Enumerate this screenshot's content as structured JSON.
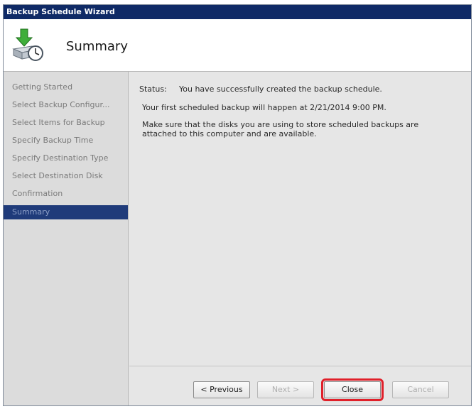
{
  "window": {
    "title": "Backup Schedule Wizard"
  },
  "header": {
    "title": "Summary"
  },
  "nav": {
    "items": [
      {
        "label": "Getting Started"
      },
      {
        "label": "Select Backup Configur..."
      },
      {
        "label": "Select Items for Backup"
      },
      {
        "label": "Specify Backup Time"
      },
      {
        "label": "Specify Destination Type"
      },
      {
        "label": "Select Destination Disk"
      },
      {
        "label": "Confirmation"
      },
      {
        "label": "Summary"
      }
    ],
    "selected_index": 7
  },
  "content": {
    "status_label": "Status:",
    "status_text": "You have successfully created the backup schedule.",
    "first_backup": "Your first scheduled backup will happen at 2/21/2014 9:00 PM.",
    "note": "Make sure that the disks you are using to store scheduled backups are attached to this computer and are available."
  },
  "buttons": {
    "previous": "< Previous",
    "next": "Next >",
    "close": "Close",
    "cancel": "Cancel"
  },
  "colors": {
    "titlebar": "#0f2a66",
    "nav_selected": "#1f3b7a",
    "highlight": "#e0202a"
  },
  "icons": {
    "header": "backup-wizard-icon"
  }
}
